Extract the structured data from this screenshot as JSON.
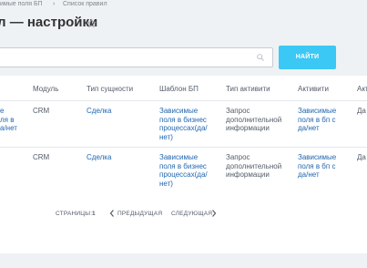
{
  "breadcrumbs": {
    "items": [
      "имые поля БП",
      "Список правил"
    ],
    "separator": "›"
  },
  "header": {
    "title": "л — настройки",
    "star_icon": "star-icon"
  },
  "search": {
    "value": "",
    "placeholder": "",
    "icon": "search-icon",
    "button_label": "НАЙТИ"
  },
  "grid": {
    "columns": [
      "Модуль",
      "Тип сущности",
      "Шаблон БП",
      "Тип активити",
      "Активити",
      "Акт"
    ],
    "rows": [
      {
        "first": "е\nля в\nа/нет",
        "module": "CRM",
        "entity": "Сделка",
        "template": "Зависимые\nполя в бизнес\nпроцессах(да/\nнет)",
        "activity_type": "Запрос\nдополнительной\nинформации",
        "activity": "Зависимые\nполя в бп с\nда/нет",
        "last": "Да"
      },
      {
        "first": "",
        "module": "CRM",
        "entity": "Сделка",
        "template": "Зависимые\nполя в бизнес\nпроцессах(да/\nнет)",
        "activity_type": "Запрос\nдополнительной\nинформации",
        "activity": "Зависимые\nполя в бп с\nда/нет",
        "last": "Да"
      }
    ]
  },
  "pager": {
    "pages_label": "СТРАНИЦЫ:",
    "current_page": "1",
    "prev_label": "ПРЕДЫДУЩАЯ",
    "next_label": "СЛЕДУЮЩАЯ"
  },
  "colors": {
    "accent": "#3bc8f5",
    "link": "#2067b0",
    "background": "#eef2f4"
  }
}
